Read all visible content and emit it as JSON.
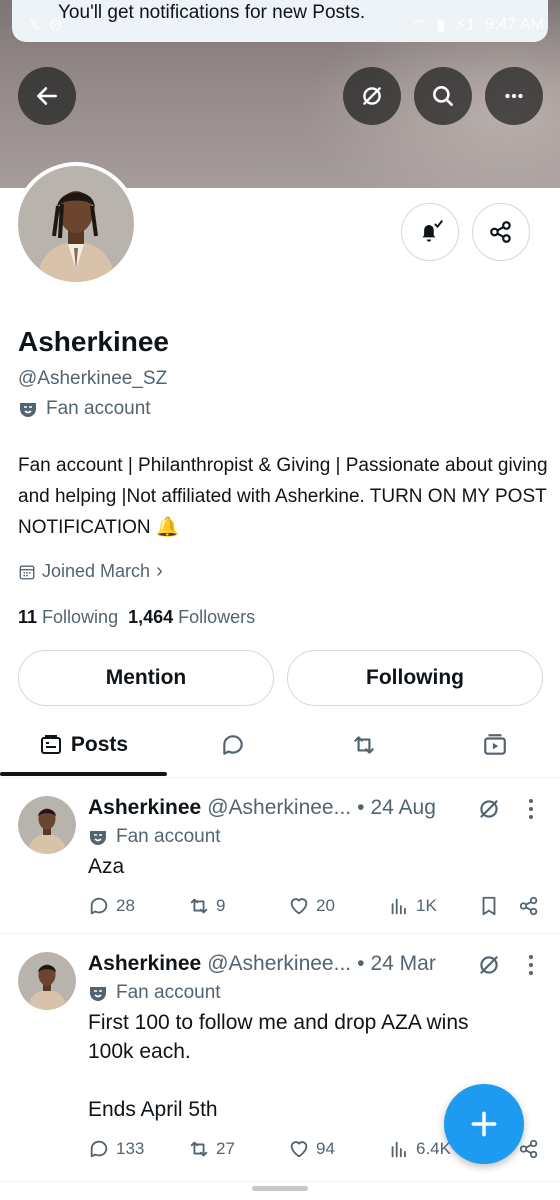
{
  "toast": {
    "text": "You'll get notifications for new Posts."
  },
  "statusbar": {
    "time": "9:47 AM",
    "battery_hint": "1"
  },
  "profile": {
    "name": "Asherkinee",
    "handle": "@Asherkinee_SZ",
    "label": "Fan account",
    "bio": "Fan account | Philanthropist & Giving | Passionate about giving and helping |Not affiliated with Asherkine. TURN ON MY POST NOTIFICATION 🔔",
    "joined": "Joined March",
    "following_count": "11",
    "following_label": "Following",
    "followers_count": "1,464",
    "followers_label": "Followers"
  },
  "buttons": {
    "mention": "Mention",
    "following": "Following"
  },
  "tabs": {
    "posts": "Posts"
  },
  "posts": [
    {
      "name": "Asherkinee",
      "handle": "@Asherkinee...",
      "dot": "•",
      "date": "24 Aug",
      "label": "Fan account",
      "text": "Aza",
      "replies": "28",
      "reposts": "9",
      "likes": "20",
      "views": "1K"
    },
    {
      "name": "Asherkinee",
      "handle": "@Asherkinee...",
      "dot": "•",
      "date": "24 Mar",
      "label": "Fan account",
      "text": "First 100 to follow me and drop AZA wins 100k each.\n\nEnds April 5th",
      "replies": "133",
      "reposts": "27",
      "likes": "94",
      "views": "6.4K"
    }
  ],
  "colors": {
    "accent": "#1d9bf0",
    "text": "#0f1419",
    "muted": "#536471",
    "border": "#cfd9de"
  }
}
